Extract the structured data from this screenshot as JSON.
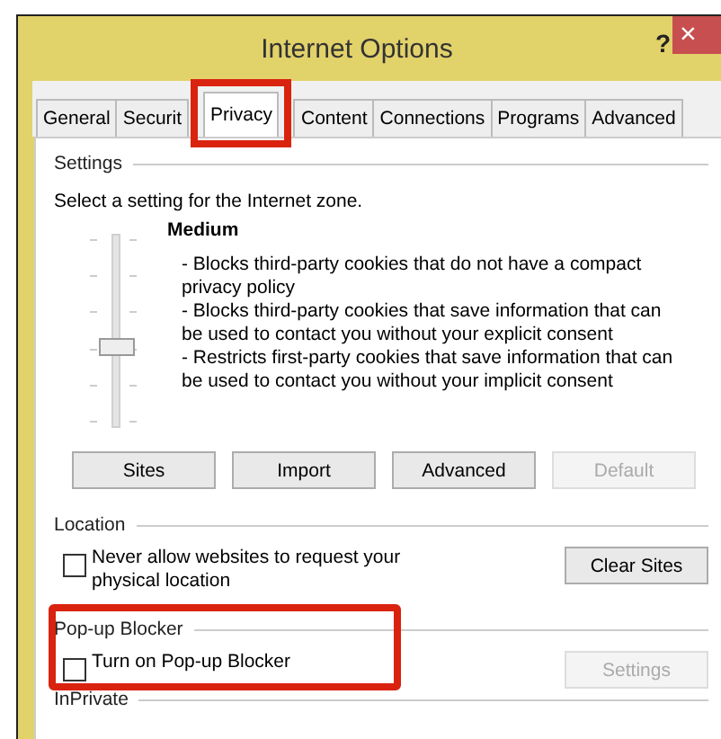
{
  "window": {
    "title": "Internet Options",
    "help": "?",
    "close": "×"
  },
  "tabs": [
    {
      "label": "General",
      "selected": false,
      "highlighted": false
    },
    {
      "label": "Securit",
      "selected": false,
      "highlighted": false
    },
    {
      "label": "Privacy",
      "selected": true,
      "highlighted": true
    },
    {
      "label": "Content",
      "selected": false,
      "highlighted": false
    },
    {
      "label": "Connections",
      "selected": false,
      "highlighted": false
    },
    {
      "label": "Programs",
      "selected": false,
      "highlighted": false
    },
    {
      "label": "Advanced",
      "selected": false,
      "highlighted": false
    }
  ],
  "settings": {
    "heading": "Settings",
    "prompt": "Select a setting for the Internet zone.",
    "level_name": "Medium",
    "slider": {
      "level": 0.4
    },
    "description": [
      "- Blocks third-party cookies that do not have a compact privacy policy",
      "- Blocks third-party cookies that save information that can be used to contact you without your explicit consent",
      "- Restricts first-party cookies that save information that can be used to contact you without your implicit consent"
    ],
    "buttons": [
      {
        "label": "Sites",
        "disabled": false
      },
      {
        "label": "Import",
        "disabled": false
      },
      {
        "label": "Advanced",
        "disabled": false
      },
      {
        "label": "Default",
        "disabled": true
      }
    ]
  },
  "location": {
    "heading": "Location",
    "checkbox": {
      "label": "Never allow websites to request your physical location",
      "checked": false
    },
    "button": {
      "label": "Clear Sites",
      "disabled": false
    }
  },
  "popup_blocker": {
    "heading": "Pop-up Blocker",
    "checkbox": {
      "label": "Turn on Pop-up Blocker",
      "checked": false
    },
    "button": {
      "label": "Settings",
      "disabled": true
    },
    "highlighted": true
  },
  "inprivate": {
    "heading": "InPrivate"
  }
}
